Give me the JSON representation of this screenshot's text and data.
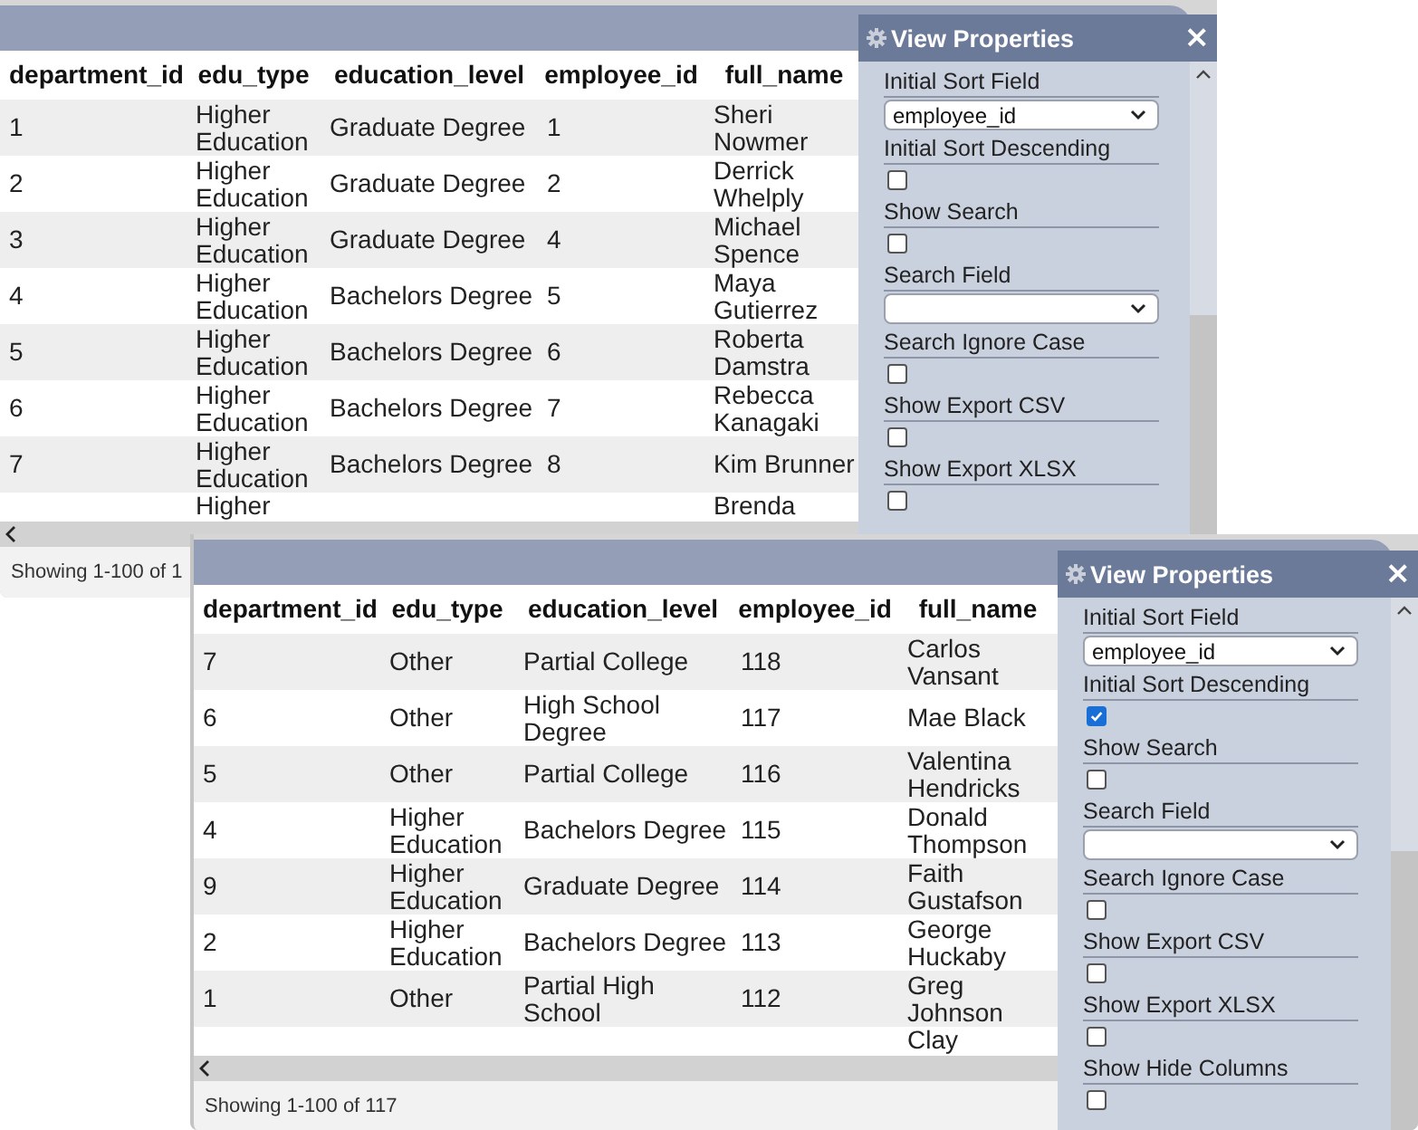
{
  "windows": [
    {
      "columns": [
        "department_id",
        "edu_type",
        "education_level",
        "employee_id",
        "full_name"
      ],
      "rows": [
        [
          "1",
          "Higher Education",
          "Graduate Degree",
          "1",
          "Sheri Nowmer"
        ],
        [
          "2",
          "Higher Education",
          "Graduate Degree",
          "2",
          "Derrick Whelply"
        ],
        [
          "3",
          "Higher Education",
          "Graduate Degree",
          "4",
          "Michael Spence"
        ],
        [
          "4",
          "Higher Education",
          "Bachelors Degree",
          "5",
          "Maya Gutierrez"
        ],
        [
          "5",
          "Higher Education",
          "Bachelors Degree",
          "6",
          "Roberta Damstra"
        ],
        [
          "6",
          "Higher Education",
          "Bachelors Degree",
          "7",
          "Rebecca Kanagaki"
        ],
        [
          "7",
          "Higher Education",
          "Bachelors Degree",
          "8",
          "Kim Brunner"
        ]
      ],
      "cut_row": {
        "column_2": "Higher",
        "column_5": "Brenda"
      },
      "footer": "Showing 1-100 of 1",
      "properties": {
        "title": "View Properties",
        "close": "×",
        "fields": [
          {
            "kind": "select",
            "label": "Initial Sort Field",
            "value": "employee_id"
          },
          {
            "kind": "checkbox",
            "label": "Initial Sort Descending",
            "checked": false
          },
          {
            "kind": "checkbox",
            "label": "Show Search",
            "checked": false
          },
          {
            "kind": "select",
            "label": "Search Field"
          },
          {
            "kind": "checkbox",
            "label": "Search Ignore Case",
            "checked": false
          },
          {
            "kind": "checkbox",
            "label": "Show Export CSV",
            "checked": false
          },
          {
            "kind": "checkbox",
            "label": "Show Export XLSX",
            "checked": false
          }
        ]
      }
    },
    {
      "columns": [
        "department_id",
        "edu_type",
        "education_level",
        "employee_id",
        "full_name"
      ],
      "rows": [
        [
          "7",
          "Other",
          "Partial College",
          "118",
          "Carlos Vansant"
        ],
        [
          "6",
          "Other",
          "High School Degree",
          "117",
          "Mae Black"
        ],
        [
          "5",
          "Other",
          "Partial College",
          "116",
          "Valentina Hendricks"
        ],
        [
          "4",
          "Higher Education",
          "Bachelors Degree",
          "115",
          "Donald Thompson"
        ],
        [
          "9",
          "Higher Education",
          "Graduate Degree",
          "114",
          "Faith Gustafson"
        ],
        [
          "2",
          "Higher Education",
          "Bachelors Degree",
          "113",
          "George Huckaby"
        ],
        [
          "1",
          "Other",
          "Partial High School",
          "112",
          "Greg Johnson"
        ]
      ],
      "cut_row": {
        "column_5": "Clay"
      },
      "footer": "Showing 1-100 of 117",
      "properties": {
        "title": "View Properties",
        "close": "×",
        "fields": [
          {
            "kind": "select",
            "label": "Initial Sort Field",
            "value": "employee_id"
          },
          {
            "kind": "checkbox",
            "label": "Initial Sort Descending",
            "checked": true
          },
          {
            "kind": "checkbox",
            "label": "Show Search",
            "checked": false
          },
          {
            "kind": "select",
            "label": "Search Field"
          },
          {
            "kind": "checkbox",
            "label": "Search Ignore Case",
            "checked": false
          },
          {
            "kind": "checkbox",
            "label": "Show Export CSV",
            "checked": false
          },
          {
            "kind": "checkbox",
            "label": "Show Export XLSX",
            "checked": false
          },
          {
            "kind": "checkbox",
            "label": "Show Hide Columns",
            "checked": false
          }
        ]
      }
    }
  ]
}
